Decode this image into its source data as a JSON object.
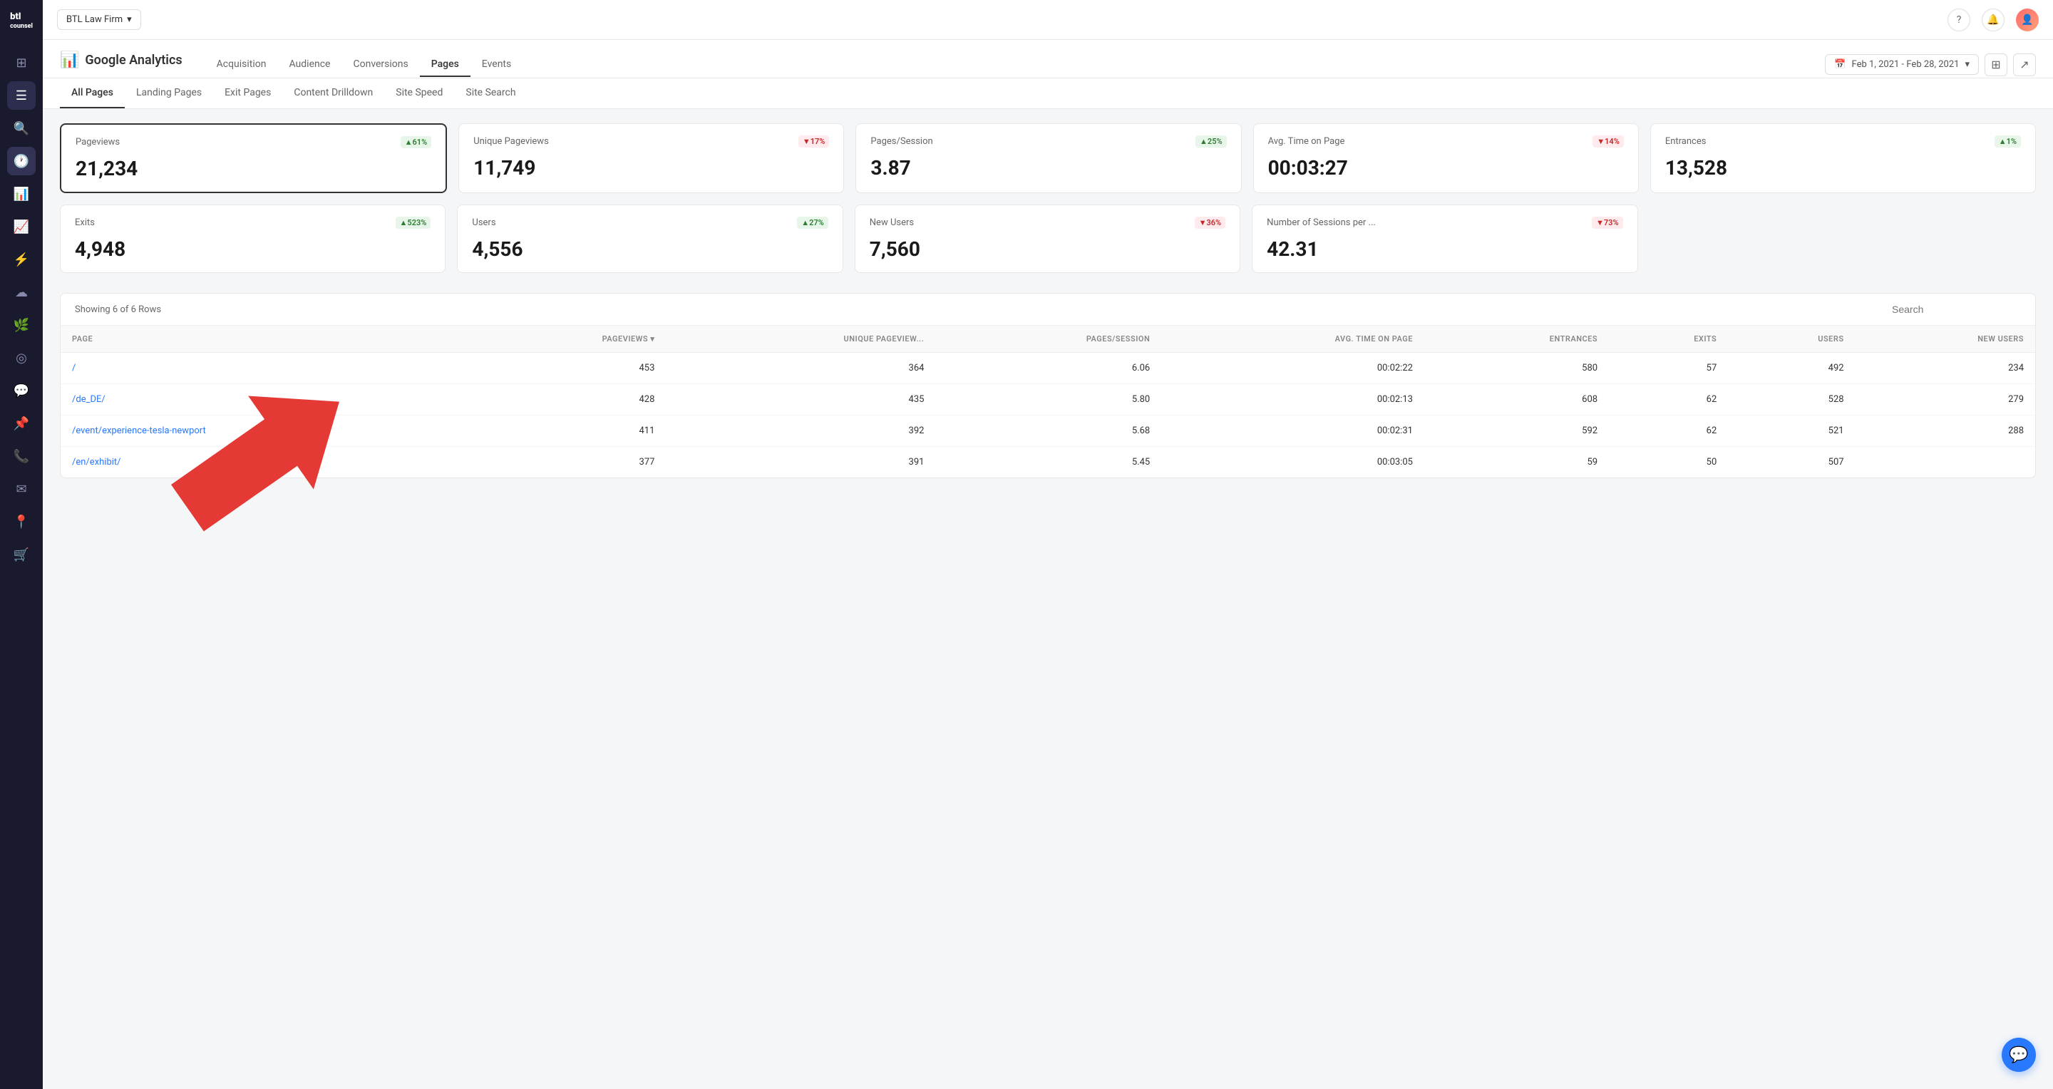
{
  "app": {
    "firm_label": "BTL Law Firm",
    "firm_dropdown_icon": "▾"
  },
  "topbar": {
    "help_icon": "?",
    "bell_icon": "🔔",
    "avatar_icon": "👤"
  },
  "analytics": {
    "title": "Google Analytics",
    "icon": "📊",
    "nav_items": [
      {
        "label": "Acquisition",
        "active": false
      },
      {
        "label": "Audience",
        "active": false
      },
      {
        "label": "Conversions",
        "active": false
      },
      {
        "label": "Pages",
        "active": true
      },
      {
        "label": "Events",
        "active": false
      }
    ],
    "date_range": "Feb 1, 2021 - Feb 28, 2021"
  },
  "sub_tabs": [
    {
      "label": "All Pages",
      "active": true
    },
    {
      "label": "Landing Pages",
      "active": false
    },
    {
      "label": "Exit Pages",
      "active": false
    },
    {
      "label": "Content Drilldown",
      "active": false
    },
    {
      "label": "Site Speed",
      "active": false
    },
    {
      "label": "Site Search",
      "active": false
    }
  ],
  "metrics_row1": [
    {
      "label": "Pageviews",
      "value": "21,234",
      "badge": "▲61%",
      "badge_type": "green",
      "selected": true
    },
    {
      "label": "Unique Pageviews",
      "value": "11,749",
      "badge": "▼17%",
      "badge_type": "red",
      "selected": false
    },
    {
      "label": "Pages/Session",
      "value": "3.87",
      "badge": "▲25%",
      "badge_type": "green",
      "selected": false
    },
    {
      "label": "Avg. Time on Page",
      "value": "00:03:27",
      "badge": "▼14%",
      "badge_type": "red",
      "selected": false
    },
    {
      "label": "Entrances",
      "value": "13,528",
      "badge": "▲1%",
      "badge_type": "green",
      "selected": false
    }
  ],
  "metrics_row2": [
    {
      "label": "Exits",
      "value": "4,948",
      "badge": "▲523%",
      "badge_type": "green",
      "selected": false
    },
    {
      "label": "Users",
      "value": "4,556",
      "badge": "▲27%",
      "badge_type": "green",
      "selected": false
    },
    {
      "label": "New Users",
      "value": "7,560",
      "badge": "▼36%",
      "badge_type": "red",
      "selected": false
    },
    {
      "label": "Number of Sessions per ...",
      "value": "42.31",
      "badge": "▼73%",
      "badge_type": "red",
      "selected": false
    }
  ],
  "table": {
    "showing_text": "Showing 6 of 6 Rows",
    "search_placeholder": "Search",
    "columns": [
      "PAGE",
      "PAGEVIEWS",
      "UNIQUE PAGEVIEW...",
      "PAGES/SESSION",
      "AVG. TIME ON PAGE",
      "ENTRANCES",
      "EXITS",
      "USERS",
      "NEW USERS"
    ],
    "rows": [
      {
        "page": "/",
        "pageviews": "453",
        "unique_pageviews": "364",
        "pages_session": "6.06",
        "avg_time": "00:02:22",
        "entrances": "580",
        "exits": "57",
        "users": "492",
        "new_users": "234"
      },
      {
        "page": "/de_DE/",
        "pageviews": "428",
        "unique_pageviews": "435",
        "pages_session": "5.80",
        "avg_time": "00:02:13",
        "entrances": "608",
        "exits": "62",
        "users": "528",
        "new_users": "279"
      },
      {
        "page": "/event/experience-tesla-newport",
        "pageviews": "411",
        "unique_pageviews": "392",
        "pages_session": "5.68",
        "avg_time": "00:02:31",
        "entrances": "592",
        "exits": "62",
        "users": "521",
        "new_users": "288"
      },
      {
        "page": "/en/exhibit/",
        "pageviews": "377",
        "unique_pageviews": "391",
        "pages_session": "5.45",
        "avg_time": "00:03:05",
        "entrances": "59",
        "exits": "50",
        "users": "507",
        "new_users": ""
      }
    ]
  },
  "sidebar": {
    "items": [
      {
        "icon": "⊞",
        "name": "grid-icon"
      },
      {
        "icon": "☰",
        "name": "menu-icon"
      },
      {
        "icon": "🔍",
        "name": "search-icon"
      },
      {
        "icon": "🕐",
        "name": "clock-icon",
        "active": true
      },
      {
        "icon": "📊",
        "name": "bar-chart-icon"
      },
      {
        "icon": "📈",
        "name": "line-chart-icon"
      },
      {
        "icon": "⚡",
        "name": "lightning-icon"
      },
      {
        "icon": "☁",
        "name": "cloud-icon"
      },
      {
        "icon": "🌱",
        "name": "leaf-icon"
      },
      {
        "icon": "◎",
        "name": "target-icon"
      },
      {
        "icon": "💬",
        "name": "comment-icon"
      },
      {
        "icon": "📌",
        "name": "pin-icon"
      },
      {
        "icon": "📞",
        "name": "phone-icon"
      },
      {
        "icon": "✉",
        "name": "mail-icon"
      },
      {
        "icon": "📍",
        "name": "location-icon"
      },
      {
        "icon": "🛒",
        "name": "cart-icon"
      }
    ]
  }
}
